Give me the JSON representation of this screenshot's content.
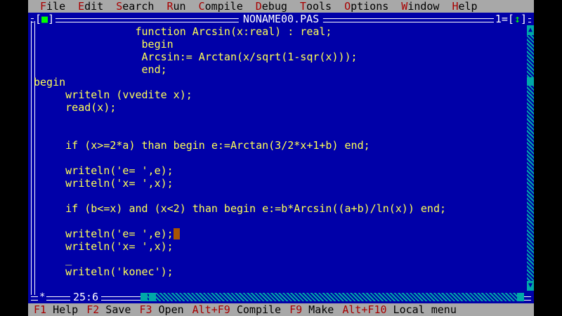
{
  "menubar": {
    "items": [
      {
        "hot": "F",
        "rest": "ile"
      },
      {
        "hot": "E",
        "rest": "dit"
      },
      {
        "hot": "S",
        "rest": "earch"
      },
      {
        "hot": "R",
        "rest": "un"
      },
      {
        "hot": "C",
        "rest": "ompile"
      },
      {
        "hot": "D",
        "rest": "ebug"
      },
      {
        "hot": "T",
        "rest": "ools"
      },
      {
        "hot": "O",
        "rest": "ptions"
      },
      {
        "hot": "W",
        "rest": "indow"
      },
      {
        "hot": "H",
        "rest": "elp"
      }
    ]
  },
  "window": {
    "close_box_left": "[",
    "close_box_mark": "■",
    "close_box_right": "]",
    "title": "NONAME00.PAS",
    "number": "1=[",
    "number_arrow": "↕",
    "number_close": "]"
  },
  "editor": {
    "lines": [
      "                function Arcsin(x:real) : real;",
      "                 begin",
      "                 Arcsin:= Arctan(x/sqrt(1-sqr(x)));",
      "                 end;",
      "begin",
      "     writeln (vvedite x);",
      "     read(x);",
      "",
      "",
      "     if (x>=2*a) than begin e:=Arctan(3/2*x+1+b) end;",
      "",
      "     writeln('e= ',e);",
      "     writeln('x= ',x);",
      "",
      "     if (b<=x) and (x<2) than begin e:=b*Arcsin((a+b)/ln(x)) end;",
      "",
      "     writeln('e= ',e);",
      "     writeln('x= ',x);",
      "     _",
      "     writeln('konec');"
    ],
    "cursor_line_index": 16
  },
  "status": {
    "star": "*",
    "position": "25:6"
  },
  "fkeys": [
    {
      "key": "F1",
      "label": " Help"
    },
    {
      "key": "F2",
      "label": " Save"
    },
    {
      "key": "F3",
      "label": " Open"
    },
    {
      "key": "Alt+F9",
      "label": " Compile"
    },
    {
      "key": "F9",
      "label": " Make"
    },
    {
      "key": "Alt+F10",
      "label": " Local menu"
    }
  ],
  "colors": {
    "desktop_blue": "#0000a8",
    "code_yellow": "#ffff55",
    "menu_gray": "#a8a8a8",
    "hotkey_red": "#a80000",
    "scroll_cyan": "#00a8a8",
    "cursor_orange": "#a85400"
  }
}
